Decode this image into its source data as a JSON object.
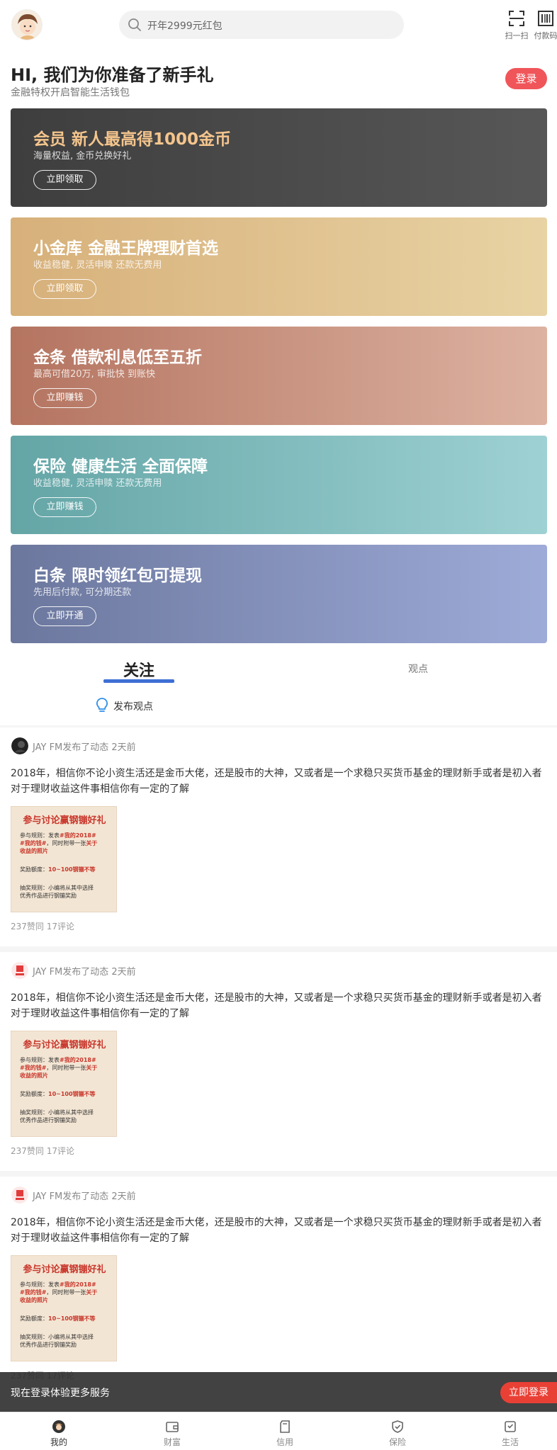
{
  "header": {
    "search_placeholder": "开年2999元红包",
    "scan_label": "扫一扫",
    "paycode_label": "付款码"
  },
  "greeting": {
    "title": "HI, 我们为你准备了新手礼",
    "subtitle": "金融特权开启智能生活钱包",
    "login_label": "登录"
  },
  "cards": [
    {
      "title": "会员 新人最高得1000金币",
      "subtitle": "海量权益, 金币兑换好礼",
      "button": "立即领取"
    },
    {
      "title": "小金库 金融王牌理财首选",
      "subtitle": "收益稳健, 灵活申赎 还款无费用",
      "button": "立即领取"
    },
    {
      "title": "金条 借款利息低至五折",
      "subtitle": "最高可借20万, 审批快 到账快",
      "button": "立即赚钱"
    },
    {
      "title": "保险 健康生活 全面保障",
      "subtitle": "收益稳健, 灵活申赎 还款无费用",
      "button": "立即赚钱"
    },
    {
      "title": "白条 限时领红包可提现",
      "subtitle": "先用后付款, 可分期还款",
      "button": "立即开通"
    }
  ],
  "tabs": {
    "active": "关注",
    "other": "观点"
  },
  "publish_label": "发布观点",
  "posts": [
    {
      "meta": "JAY FM发布了动态 2天前",
      "text": "2018年，相信你不论小资生活还是金币大佬，还是股市的大神，又或者是一个求稳只买货币基金的理财新手或者是初入者对于理财收益这件事相信你有一定的了解",
      "stats": "237赞同 17评论"
    },
    {
      "meta": "JAY FM发布了动态 2天前",
      "text": "2018年，相信你不论小资生活还是金币大佬，还是股市的大神，又或者是一个求稳只买货币基金的理财新手或者是初入者对于理财收益这件事相信你有一定的了解",
      "stats": "237赞同 17评论"
    },
    {
      "meta": "JAY FM发布了动态 2天前",
      "text": "2018年，相信你不论小资生活还是金币大佬，还是股市的大神，又或者是一个求稳只买货币基金的理财新手或者是初入者对于理财收益这件事相信你有一定的了解",
      "stats": "237赞同 17评论"
    }
  ],
  "promo_image": {
    "title": "参与讨论赢钢镚好礼",
    "line1_prefix": "参与规则：发表",
    "line1_tag": "#我的2018#",
    "line2_tag": "#我的钱#",
    "line2_rest": "，同时附带一张",
    "line2_hl": "关于",
    "line3_hl": "收益的照片",
    "reward_prefix": "奖励额度：",
    "reward_value": "10~100钢镚不等",
    "lottery1": "抽奖规则：小编将从其中选择",
    "lottery2": "优秀作品进行钢镚奖励"
  },
  "login_banner": {
    "text": "现在登录体验更多服务",
    "button": "立即登录"
  },
  "bottom_nav": [
    {
      "label": "我的",
      "icon": "profile-icon"
    },
    {
      "label": "财富",
      "icon": "wallet-icon"
    },
    {
      "label": "信用",
      "icon": "card-icon"
    },
    {
      "label": "保险",
      "icon": "shield-icon"
    },
    {
      "label": "生活",
      "icon": "life-icon"
    }
  ],
  "colors": {
    "accent_blue": "#3e6fd4",
    "login_red": "#f0555a",
    "banner_red": "#e94036"
  }
}
